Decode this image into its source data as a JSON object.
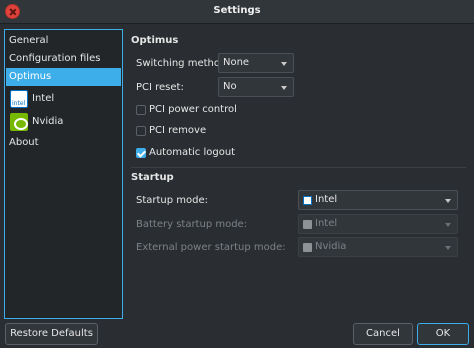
{
  "window": {
    "title": "Settings"
  },
  "sidebar": {
    "items": [
      {
        "label": "General"
      },
      {
        "label": "Configuration files"
      },
      {
        "label": "Optimus"
      },
      {
        "label": "Intel",
        "icon": "intel-logo-icon"
      },
      {
        "label": "Nvidia",
        "icon": "nvidia-logo-icon"
      },
      {
        "label": "About"
      }
    ],
    "selected": "Optimus"
  },
  "optimus": {
    "heading": "Optimus",
    "switching_method": {
      "label": "Switching method:",
      "value": "None"
    },
    "pci_reset": {
      "label": "PCI reset:",
      "value": "No"
    },
    "pci_power_control": {
      "label": "PCI power control",
      "checked": false
    },
    "pci_remove": {
      "label": "PCI remove",
      "checked": false
    },
    "automatic_logout": {
      "label": "Automatic logout",
      "checked": true
    }
  },
  "startup": {
    "heading": "Startup",
    "startup_mode": {
      "label": "Startup mode:",
      "value": "Intel",
      "enabled": true
    },
    "battery_startup_mode": {
      "label": "Battery startup mode:",
      "value": "Intel",
      "enabled": false
    },
    "external_power_startup_mode": {
      "label": "External power startup mode:",
      "value": "Nvidia",
      "enabled": false
    }
  },
  "buttons": {
    "restore_defaults": "Restore Defaults",
    "cancel": "Cancel",
    "ok": "OK"
  },
  "colors": {
    "accent": "#3daee9",
    "background": "#2a2e32",
    "sidebar_bg": "#232629",
    "close_button": "#e0433b",
    "nvidia_green": "#76b900",
    "intel_blue": "#0071c5"
  }
}
